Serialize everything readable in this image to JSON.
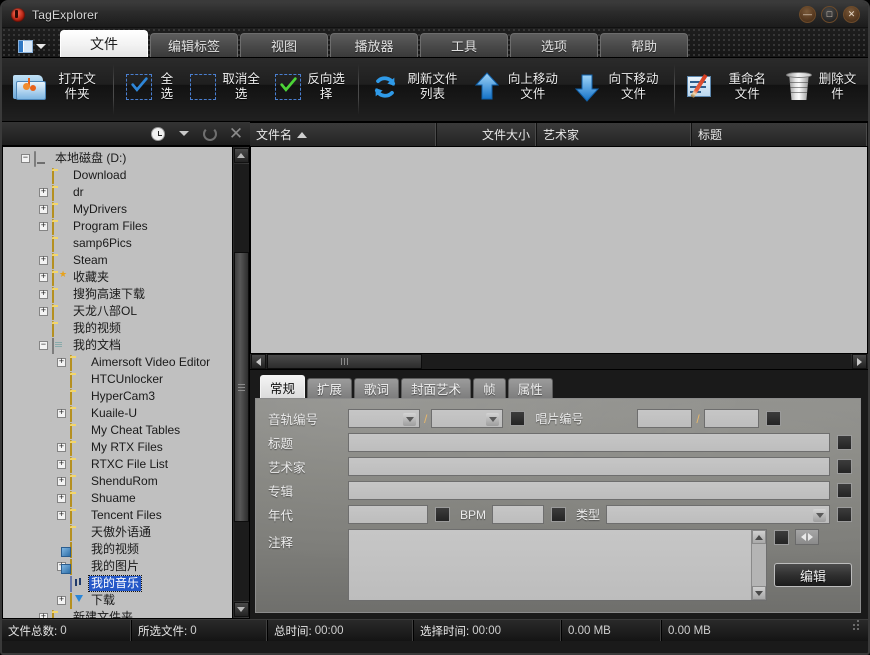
{
  "window": {
    "title": "TagExplorer",
    "app_icon": "music-disc-icon",
    "buttons": {
      "minimize": "—",
      "maximize": "□",
      "close": "✕"
    }
  },
  "ribbon": {
    "app_menu_icon": "app-menu-icon",
    "tabs": [
      {
        "label": "文件",
        "active": true
      },
      {
        "label": "编辑标签",
        "active": false
      },
      {
        "label": "视图",
        "active": false
      },
      {
        "label": "播放器",
        "active": false
      },
      {
        "label": "工具",
        "active": false
      },
      {
        "label": "选项",
        "active": false
      },
      {
        "label": "帮助",
        "active": false
      }
    ],
    "buttons": [
      {
        "label": "打开文件夹",
        "icon": "open-folder-icon"
      },
      {
        "label": "全选",
        "icon": "check-all-icon"
      },
      {
        "label": "取消全选",
        "icon": "uncheck-all-icon"
      },
      {
        "label": "反向选择",
        "icon": "invert-selection-icon"
      },
      {
        "label": "刷新文件列表",
        "icon": "refresh-icon"
      },
      {
        "label": "向上移动文件",
        "icon": "arrow-up-icon"
      },
      {
        "label": "向下移动文件",
        "icon": "arrow-down-icon"
      },
      {
        "label": "重命名文件",
        "icon": "rename-icon"
      },
      {
        "label": "删除文件",
        "icon": "delete-trash-icon"
      }
    ]
  },
  "tree_toolbar": {
    "history_icon": "clock-icon",
    "dropdown_icon": "chevron-down-icon",
    "refresh_icon": "refresh-circle-icon",
    "close_icon": "close-x-icon"
  },
  "tree": {
    "nodes": [
      {
        "label": "本地磁盘 (D:)",
        "depth": 0,
        "expander": "minus",
        "icon": "drive-icon",
        "selected": false
      },
      {
        "label": "Download",
        "depth": 1,
        "expander": "none",
        "icon": "folder-icon",
        "selected": false
      },
      {
        "label": "dr",
        "depth": 1,
        "expander": "plus",
        "icon": "folder-icon",
        "selected": false
      },
      {
        "label": "MyDrivers",
        "depth": 1,
        "expander": "plus",
        "icon": "folder-icon",
        "selected": false
      },
      {
        "label": "Program Files",
        "depth": 1,
        "expander": "plus",
        "icon": "folder-icon",
        "selected": false
      },
      {
        "label": "samp6Pics",
        "depth": 1,
        "expander": "none",
        "icon": "folder-icon",
        "selected": false
      },
      {
        "label": "Steam",
        "depth": 1,
        "expander": "plus",
        "icon": "folder-icon",
        "selected": false
      },
      {
        "label": "收藏夹",
        "depth": 1,
        "expander": "plus",
        "icon": "favorites-folder-icon",
        "selected": false
      },
      {
        "label": "搜狗高速下载",
        "depth": 1,
        "expander": "plus",
        "icon": "folder-icon",
        "selected": false
      },
      {
        "label": "天龙八部OL",
        "depth": 1,
        "expander": "plus",
        "icon": "folder-icon",
        "selected": false
      },
      {
        "label": "我的视频",
        "depth": 1,
        "expander": "none",
        "icon": "folder-icon",
        "selected": false
      },
      {
        "label": "我的文档",
        "depth": 1,
        "expander": "minus",
        "icon": "documents-icon",
        "selected": false
      },
      {
        "label": "Aimersoft Video Editor",
        "depth": 2,
        "expander": "plus",
        "icon": "folder-icon",
        "selected": false
      },
      {
        "label": "HTCUnlocker",
        "depth": 2,
        "expander": "none",
        "icon": "folder-icon",
        "selected": false
      },
      {
        "label": "HyperCam3",
        "depth": 2,
        "expander": "none",
        "icon": "folder-icon",
        "selected": false
      },
      {
        "label": "Kuaile-U",
        "depth": 2,
        "expander": "plus",
        "icon": "folder-icon",
        "selected": false
      },
      {
        "label": "My Cheat Tables",
        "depth": 2,
        "expander": "none",
        "icon": "folder-icon",
        "selected": false
      },
      {
        "label": "My RTX Files",
        "depth": 2,
        "expander": "plus",
        "icon": "folder-icon",
        "selected": false
      },
      {
        "label": "RTXC File List",
        "depth": 2,
        "expander": "plus",
        "icon": "folder-icon",
        "selected": false
      },
      {
        "label": "ShenduRom",
        "depth": 2,
        "expander": "plus",
        "icon": "folder-icon",
        "selected": false
      },
      {
        "label": "Shuame",
        "depth": 2,
        "expander": "plus",
        "icon": "folder-icon",
        "selected": false
      },
      {
        "label": "Tencent Files",
        "depth": 2,
        "expander": "plus",
        "icon": "folder-icon",
        "selected": false
      },
      {
        "label": "天傲外语通",
        "depth": 2,
        "expander": "none",
        "icon": "folder-icon",
        "selected": false
      },
      {
        "label": "我的视频",
        "depth": 2,
        "expander": "none",
        "icon": "my-videos-icon",
        "selected": false
      },
      {
        "label": "我的图片",
        "depth": 2,
        "expander": "plus",
        "icon": "my-pictures-icon",
        "selected": false
      },
      {
        "label": "我的音乐",
        "depth": 2,
        "expander": "none",
        "icon": "my-music-icon",
        "selected": true
      },
      {
        "label": "下载",
        "depth": 2,
        "expander": "plus",
        "icon": "downloads-icon",
        "selected": false
      },
      {
        "label": "新建文件夹",
        "depth": 1,
        "expander": "plus",
        "icon": "folder-icon",
        "selected": false
      }
    ]
  },
  "file_list": {
    "columns": [
      {
        "label": "文件名",
        "sorted": true,
        "sort_dir": "asc"
      },
      {
        "label": "文件大小",
        "sorted": false
      },
      {
        "label": "艺术家",
        "sorted": false
      },
      {
        "label": "标题",
        "sorted": false
      }
    ],
    "rows": []
  },
  "tag_editor": {
    "tabs": [
      {
        "label": "常规",
        "active": true
      },
      {
        "label": "扩展",
        "active": false
      },
      {
        "label": "歌词",
        "active": false
      },
      {
        "label": "封面艺术",
        "active": false
      },
      {
        "label": "帧",
        "active": false
      },
      {
        "label": "属性",
        "active": false
      }
    ],
    "fields": {
      "track_label": "音轨编号",
      "track_value": "",
      "track_total_value": "",
      "separator": "/",
      "disc_label": "唱片编号",
      "disc_value": "",
      "disc_total_value": "",
      "title_label": "标题",
      "title_value": "",
      "artist_label": "艺术家",
      "artist_value": "",
      "album_label": "专辑",
      "album_value": "",
      "year_label": "年代",
      "year_value": "",
      "bpm_label": "BPM",
      "bpm_value": "",
      "genre_label": "类型",
      "genre_value": "",
      "comment_label": "注释",
      "comment_value": ""
    },
    "edit_button": "编辑"
  },
  "status_bar": {
    "cells": [
      {
        "key": "文件总数:",
        "value": "0"
      },
      {
        "key": "所选文件:",
        "value": "0"
      },
      {
        "key": "总时间:",
        "value": "00:00"
      },
      {
        "key": "选择时间:",
        "value": "00:00"
      },
      {
        "key": "",
        "value": "0.00 MB"
      },
      {
        "key": "",
        "value": "0.00 MB"
      }
    ]
  },
  "colors": {
    "accent_blue": "#2458c8",
    "tab_active_bg": "#f4f4f4",
    "panel_bg": "#c0c0c0",
    "chrome_dark": "#1a1a1a",
    "icon_blue": "#36a0ef",
    "folder_yellow": "#efc94e"
  }
}
